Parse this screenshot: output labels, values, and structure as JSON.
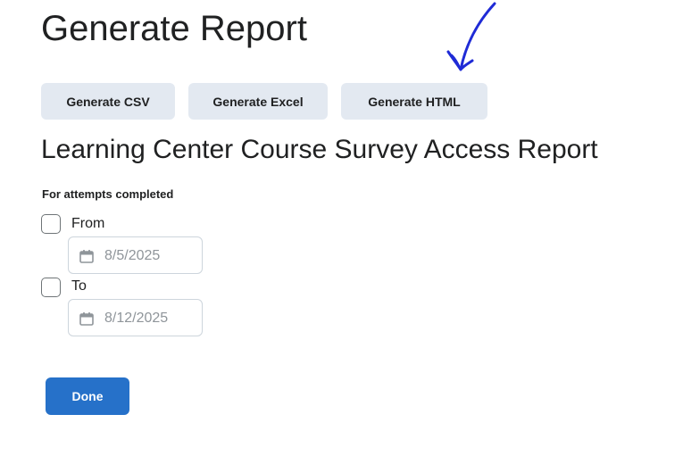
{
  "header": {
    "title": "Generate Report"
  },
  "buttons": {
    "csv_label": "Generate CSV",
    "excel_label": "Generate Excel",
    "html_label": "Generate HTML"
  },
  "report": {
    "title": "Learning Center Course Survey Access Report"
  },
  "filters": {
    "section_label": "For attempts completed",
    "from": {
      "label": "From",
      "checked": false,
      "date": "8/5/2025",
      "icon": "calendar-icon"
    },
    "to": {
      "label": "To",
      "checked": false,
      "date": "8/12/2025",
      "icon": "calendar-icon"
    }
  },
  "footer": {
    "done_label": "Done"
  },
  "colors": {
    "primary": "#2671c9",
    "secondary_button": "#e3e9f1",
    "annotation": "#1f2bd6",
    "placeholder_text": "#8f959a"
  }
}
